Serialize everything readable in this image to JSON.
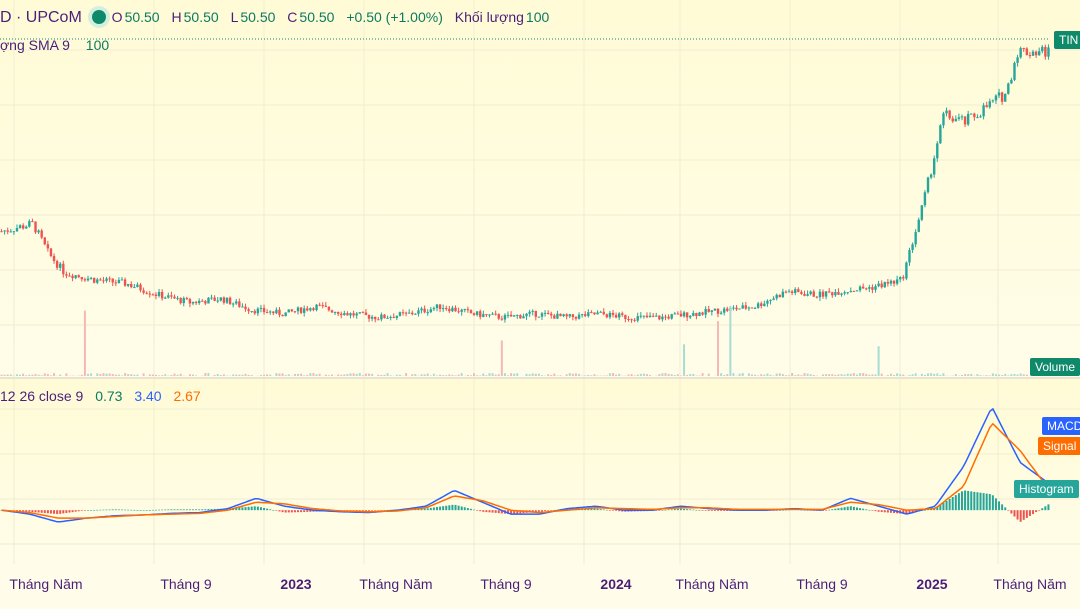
{
  "header": {
    "symbol": "D · UPCoM",
    "open_label": "O",
    "open": "50.50",
    "high_label": "H",
    "high": "50.50",
    "low_label": "L",
    "low": "50.50",
    "close_label": "C",
    "close": "50.50",
    "change": "+0.50 (+1.00%)",
    "volume_label": "Khối lượng",
    "volume": "100"
  },
  "volume_legend": {
    "label": "ợng SMA 9",
    "value": "100"
  },
  "macd_legend": {
    "label": "12 26 close 9",
    "histogram": "0.73",
    "macd": "3.40",
    "signal": "2.67"
  },
  "tags": {
    "price": "TIN",
    "volume": "Volume",
    "macd": "MACD",
    "signal": "Signal",
    "histogram": "Histogram"
  },
  "colors": {
    "up": "#26a69a",
    "down": "#ef5350",
    "macd": "#2962ff",
    "signal": "#ff6d00",
    "accent": "#0e8a6a"
  },
  "time_axis": [
    "Tháng Năm",
    "Tháng 9",
    "2023",
    "Tháng Năm",
    "Tháng 9",
    "2024",
    "Tháng Năm",
    "Tháng 9",
    "2025",
    "Tháng Năm"
  ],
  "chart_data": {
    "type": "candlestick",
    "price_series": {
      "name": "Price",
      "x": [
        0,
        0.03,
        0.045,
        0.06,
        0.09,
        0.12,
        0.15,
        0.18,
        0.21,
        0.24,
        0.27,
        0.3,
        0.33,
        0.36,
        0.39,
        0.42,
        0.45,
        0.48,
        0.51,
        0.54,
        0.57,
        0.6,
        0.63,
        0.66,
        0.69,
        0.72,
        0.75,
        0.78,
        0.8,
        0.83,
        0.86,
        0.88,
        0.9,
        0.92,
        0.94,
        0.96,
        0.97
      ],
      "values": [
        26.5,
        27.5,
        23.5,
        21.0,
        20.0,
        19.5,
        18.0,
        17.0,
        17.5,
        16.0,
        15.5,
        16.5,
        15.5,
        15.0,
        15.5,
        16.5,
        15.5,
        15.0,
        15.5,
        15.0,
        15.5,
        15.0,
        15.0,
        15.5,
        16.0,
        16.5,
        18.5,
        18.0,
        18.5,
        19.0,
        20.0,
        30.0,
        42.0,
        41.0,
        43.0,
        45.0,
        50.5
      ]
    },
    "macd_series": [
      {
        "name": "MACD",
        "values": [
          0,
          -0.5,
          -1.5,
          -1.0,
          -0.7,
          -0.6,
          -0.4,
          -0.3,
          0.2,
          1.5,
          0.5,
          0,
          -0.2,
          -0.3,
          0,
          0.5,
          2.5,
          1.0,
          -0.5,
          -0.5,
          0.2,
          0.5,
          0,
          0,
          0.5,
          0.2,
          0,
          0,
          0.2,
          0,
          1.5,
          0.5,
          -0.5,
          0.5,
          5.5,
          13.0,
          6.0,
          3.4
        ]
      },
      {
        "name": "Signal",
        "values": [
          0,
          -0.3,
          -1.0,
          -1.0,
          -0.8,
          -0.6,
          -0.5,
          -0.4,
          0,
          1.0,
          0.8,
          0.2,
          -0.1,
          -0.2,
          -0.1,
          0.3,
          1.8,
          1.2,
          0,
          -0.3,
          0,
          0.3,
          0.2,
          0.1,
          0.3,
          0.3,
          0.1,
          0.1,
          0.1,
          0.1,
          1.0,
          0.7,
          0,
          0.2,
          3.0,
          11.0,
          7.5,
          2.67
        ]
      }
    ]
  }
}
